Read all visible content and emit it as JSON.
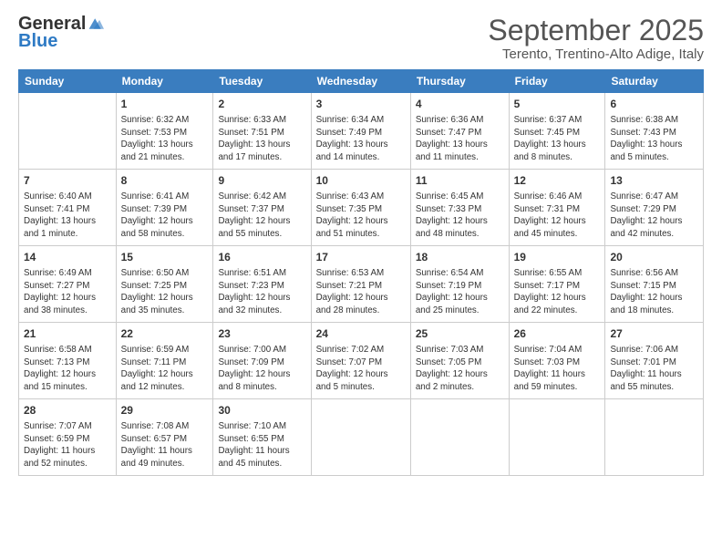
{
  "logo": {
    "general": "General",
    "blue": "Blue"
  },
  "title": "September 2025",
  "location": "Terento, Trentino-Alto Adige, Italy",
  "days_of_week": [
    "Sunday",
    "Monday",
    "Tuesday",
    "Wednesday",
    "Thursday",
    "Friday",
    "Saturday"
  ],
  "weeks": [
    [
      {
        "day": "",
        "info": ""
      },
      {
        "day": "1",
        "info": "Sunrise: 6:32 AM\nSunset: 7:53 PM\nDaylight: 13 hours\nand 21 minutes."
      },
      {
        "day": "2",
        "info": "Sunrise: 6:33 AM\nSunset: 7:51 PM\nDaylight: 13 hours\nand 17 minutes."
      },
      {
        "day": "3",
        "info": "Sunrise: 6:34 AM\nSunset: 7:49 PM\nDaylight: 13 hours\nand 14 minutes."
      },
      {
        "day": "4",
        "info": "Sunrise: 6:36 AM\nSunset: 7:47 PM\nDaylight: 13 hours\nand 11 minutes."
      },
      {
        "day": "5",
        "info": "Sunrise: 6:37 AM\nSunset: 7:45 PM\nDaylight: 13 hours\nand 8 minutes."
      },
      {
        "day": "6",
        "info": "Sunrise: 6:38 AM\nSunset: 7:43 PM\nDaylight: 13 hours\nand 5 minutes."
      }
    ],
    [
      {
        "day": "7",
        "info": "Sunrise: 6:40 AM\nSunset: 7:41 PM\nDaylight: 13 hours\nand 1 minute."
      },
      {
        "day": "8",
        "info": "Sunrise: 6:41 AM\nSunset: 7:39 PM\nDaylight: 12 hours\nand 58 minutes."
      },
      {
        "day": "9",
        "info": "Sunrise: 6:42 AM\nSunset: 7:37 PM\nDaylight: 12 hours\nand 55 minutes."
      },
      {
        "day": "10",
        "info": "Sunrise: 6:43 AM\nSunset: 7:35 PM\nDaylight: 12 hours\nand 51 minutes."
      },
      {
        "day": "11",
        "info": "Sunrise: 6:45 AM\nSunset: 7:33 PM\nDaylight: 12 hours\nand 48 minutes."
      },
      {
        "day": "12",
        "info": "Sunrise: 6:46 AM\nSunset: 7:31 PM\nDaylight: 12 hours\nand 45 minutes."
      },
      {
        "day": "13",
        "info": "Sunrise: 6:47 AM\nSunset: 7:29 PM\nDaylight: 12 hours\nand 42 minutes."
      }
    ],
    [
      {
        "day": "14",
        "info": "Sunrise: 6:49 AM\nSunset: 7:27 PM\nDaylight: 12 hours\nand 38 minutes."
      },
      {
        "day": "15",
        "info": "Sunrise: 6:50 AM\nSunset: 7:25 PM\nDaylight: 12 hours\nand 35 minutes."
      },
      {
        "day": "16",
        "info": "Sunrise: 6:51 AM\nSunset: 7:23 PM\nDaylight: 12 hours\nand 32 minutes."
      },
      {
        "day": "17",
        "info": "Sunrise: 6:53 AM\nSunset: 7:21 PM\nDaylight: 12 hours\nand 28 minutes."
      },
      {
        "day": "18",
        "info": "Sunrise: 6:54 AM\nSunset: 7:19 PM\nDaylight: 12 hours\nand 25 minutes."
      },
      {
        "day": "19",
        "info": "Sunrise: 6:55 AM\nSunset: 7:17 PM\nDaylight: 12 hours\nand 22 minutes."
      },
      {
        "day": "20",
        "info": "Sunrise: 6:56 AM\nSunset: 7:15 PM\nDaylight: 12 hours\nand 18 minutes."
      }
    ],
    [
      {
        "day": "21",
        "info": "Sunrise: 6:58 AM\nSunset: 7:13 PM\nDaylight: 12 hours\nand 15 minutes."
      },
      {
        "day": "22",
        "info": "Sunrise: 6:59 AM\nSunset: 7:11 PM\nDaylight: 12 hours\nand 12 minutes."
      },
      {
        "day": "23",
        "info": "Sunrise: 7:00 AM\nSunset: 7:09 PM\nDaylight: 12 hours\nand 8 minutes."
      },
      {
        "day": "24",
        "info": "Sunrise: 7:02 AM\nSunset: 7:07 PM\nDaylight: 12 hours\nand 5 minutes."
      },
      {
        "day": "25",
        "info": "Sunrise: 7:03 AM\nSunset: 7:05 PM\nDaylight: 12 hours\nand 2 minutes."
      },
      {
        "day": "26",
        "info": "Sunrise: 7:04 AM\nSunset: 7:03 PM\nDaylight: 11 hours\nand 59 minutes."
      },
      {
        "day": "27",
        "info": "Sunrise: 7:06 AM\nSunset: 7:01 PM\nDaylight: 11 hours\nand 55 minutes."
      }
    ],
    [
      {
        "day": "28",
        "info": "Sunrise: 7:07 AM\nSunset: 6:59 PM\nDaylight: 11 hours\nand 52 minutes."
      },
      {
        "day": "29",
        "info": "Sunrise: 7:08 AM\nSunset: 6:57 PM\nDaylight: 11 hours\nand 49 minutes."
      },
      {
        "day": "30",
        "info": "Sunrise: 7:10 AM\nSunset: 6:55 PM\nDaylight: 11 hours\nand 45 minutes."
      },
      {
        "day": "",
        "info": ""
      },
      {
        "day": "",
        "info": ""
      },
      {
        "day": "",
        "info": ""
      },
      {
        "day": "",
        "info": ""
      }
    ]
  ]
}
